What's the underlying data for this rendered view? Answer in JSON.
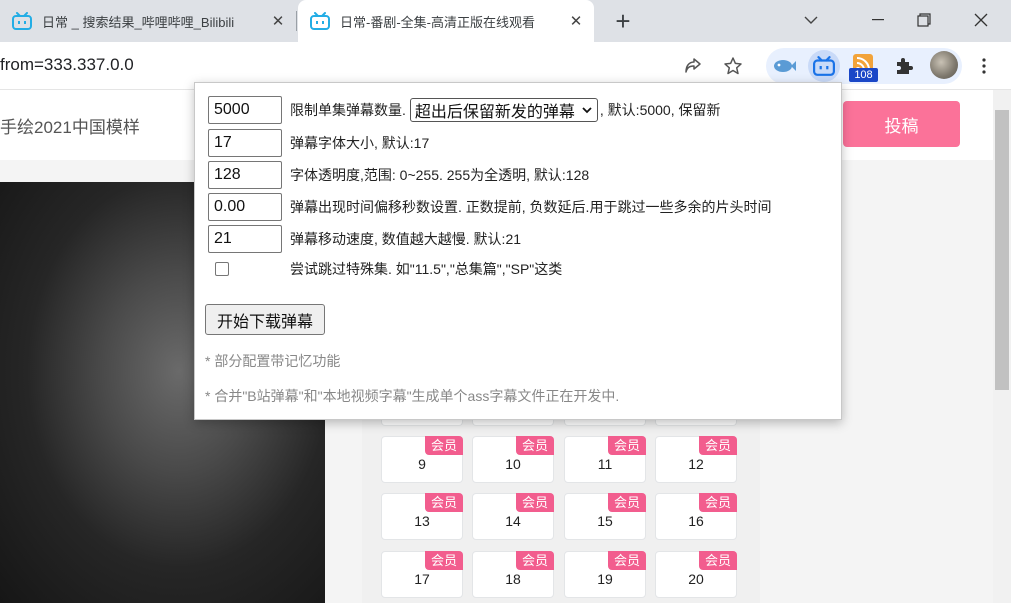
{
  "browser": {
    "tabs": [
      {
        "title": "日常 _ 搜索结果_哔哩哔哩_Bilibili",
        "close": "✕"
      },
      {
        "title": "日常-番剧-全集-高清正版在线观看",
        "close": "✕"
      }
    ],
    "new_tab": "+",
    "address": "from=333.337.0.0",
    "extension_badge": "108"
  },
  "page": {
    "search_text": "手绘2021中国模样",
    "upload_button": "投稿",
    "vip_label": "会员",
    "episodes": [
      "9",
      "10",
      "11",
      "12",
      "13",
      "14",
      "15",
      "16",
      "17",
      "18",
      "19",
      "20"
    ]
  },
  "popup": {
    "danmaku_limit": {
      "value": "5000",
      "label_before": "限制单集弹幕数量.",
      "select": "超出后保留新发的弹幕",
      "label_after": ", 默认:5000, 保留新"
    },
    "font_size": {
      "value": "17",
      "label": "弹幕字体大小, 默认:17"
    },
    "opacity": {
      "value": "128",
      "label": "字体透明度,范围: 0~255. 255为全透明, 默认:128"
    },
    "time_offset": {
      "value": "0.00",
      "label": "弹幕出现时间偏移秒数设置. 正数提前, 负数延后.用于跳过一些多余的片头时间"
    },
    "speed": {
      "value": "21",
      "label": "弹幕移动速度, 数值越大越慢. 默认:21"
    },
    "skip_special": {
      "checked": false,
      "label": "尝试跳过特殊集. 如\"11.5\",\"总集篇\",\"SP\"这类"
    },
    "start_button": "开始下载弹幕",
    "note1": "* 部分配置带记忆功能",
    "note2": "* 合并\"B站弹幕\"和\"本地视频字幕\"生成单个ass字幕文件正在开发中."
  }
}
